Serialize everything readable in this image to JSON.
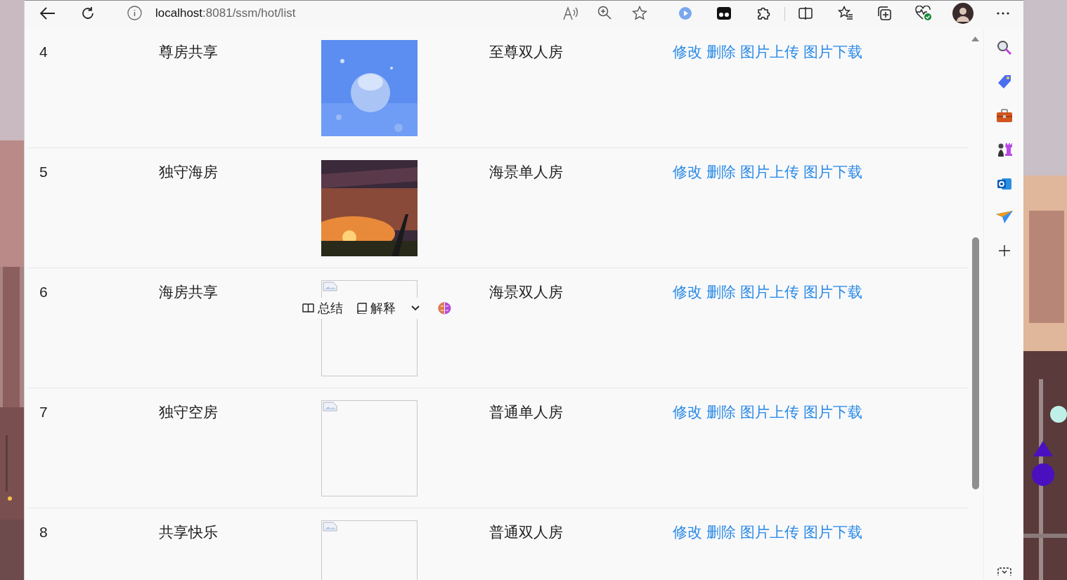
{
  "browser": {
    "url_host": "localhost",
    "url_rest": ":8081/ssm/hot/list"
  },
  "rows": [
    {
      "id": "4",
      "name": "尊房共享",
      "image": {
        "kind": "picture"
      },
      "room_type": "至尊双人房",
      "actions": [
        "修改",
        "删除",
        "图片上传",
        "图片下载"
      ]
    },
    {
      "id": "5",
      "name": "独守海房",
      "image": {
        "kind": "picture"
      },
      "room_type": "海景单人房",
      "actions": [
        "修改",
        "删除",
        "图片上传",
        "图片下载"
      ]
    },
    {
      "id": "6",
      "name": "海房共享",
      "image": {
        "kind": "broken"
      },
      "room_type": "海景双人房",
      "actions": [
        "修改",
        "删除",
        "图片上传",
        "图片下载"
      ]
    },
    {
      "id": "7",
      "name": "独守空房",
      "image": {
        "kind": "broken"
      },
      "room_type": "普通单人房",
      "actions": [
        "修改",
        "删除",
        "图片上传",
        "图片下载"
      ]
    },
    {
      "id": "8",
      "name": "共享快乐",
      "image": {
        "kind": "broken"
      },
      "room_type": "普通双人房",
      "actions": [
        "修改",
        "删除",
        "图片上传",
        "图片下载"
      ]
    }
  ],
  "selection_toolbar": {
    "buttons": [
      "总结",
      "解释"
    ]
  }
}
